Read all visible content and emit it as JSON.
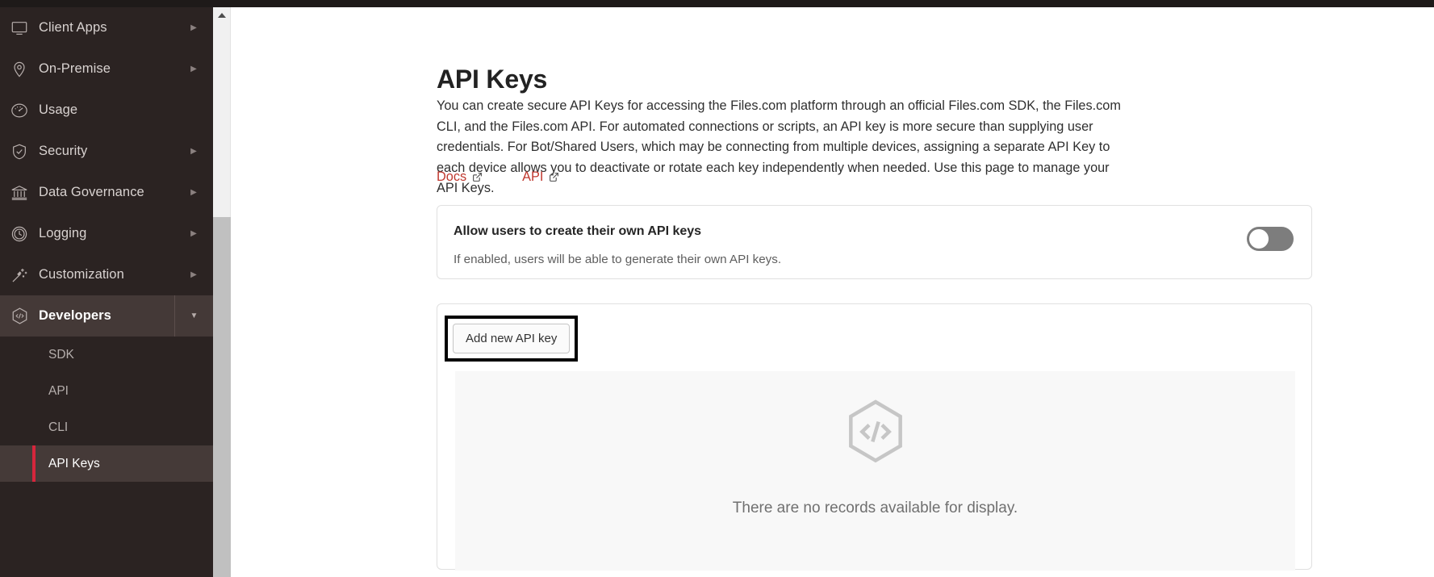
{
  "sidebar": {
    "items": [
      {
        "label": "Client Apps",
        "icon": "monitor-icon",
        "has_arrow": true,
        "arrow": "▶"
      },
      {
        "label": "On-Premise",
        "icon": "map-pin-icon",
        "has_arrow": true,
        "arrow": "▶"
      },
      {
        "label": "Usage",
        "icon": "gauge-icon",
        "has_arrow": false,
        "arrow": ""
      },
      {
        "label": "Security",
        "icon": "shield-check-icon",
        "has_arrow": true,
        "arrow": "▶"
      },
      {
        "label": "Data Governance",
        "icon": "bank-icon",
        "has_arrow": true,
        "arrow": "▶"
      },
      {
        "label": "Logging",
        "icon": "clock-icon",
        "has_arrow": true,
        "arrow": "▶"
      },
      {
        "label": "Customization",
        "icon": "magic-wand-icon",
        "has_arrow": true,
        "arrow": "▶"
      },
      {
        "label": "Developers",
        "icon": "hexagon-code-icon",
        "has_arrow": true,
        "arrow": "▼",
        "expanded": true
      }
    ],
    "developers_subitems": [
      {
        "label": "SDK",
        "active": false
      },
      {
        "label": "API",
        "active": false
      },
      {
        "label": "CLI",
        "active": false
      },
      {
        "label": "API Keys",
        "active": true
      }
    ],
    "active_item": "API Keys",
    "colors": {
      "background": "#2b2322",
      "active_background": "#453a38",
      "active_accent": "#d6263c",
      "label": "#d8d2d0"
    }
  },
  "main": {
    "title": "API Keys",
    "description": "You can create secure API Keys for accessing the Files.com platform through an official Files.com SDK, the Files.com CLI, and the Files.com API. For automated connections or scripts, an API key is more secure than supplying user credentials. For Bot/Shared Users, which may be connecting from multiple devices, assigning a separate API Key to each device allows you to deactivate or rotate each key independently when needed. Use this page to manage your API Keys.",
    "links": [
      {
        "label": "Docs",
        "icon": "external-link-icon"
      },
      {
        "label": "API",
        "icon": "external-link-icon"
      }
    ],
    "link_color": "#c0392f",
    "settings_card": {
      "title": "Allow users to create their own API keys",
      "description": "If enabled, users will be able to generate their own API keys.",
      "toggle_state": "off",
      "toggle_track_color": "#7d7d7d"
    },
    "keys_card": {
      "add_button_label": "Add new API key",
      "add_button_focused": true,
      "empty_state": {
        "icon": "hexagon-code-icon",
        "message": "There are no records available for display."
      }
    }
  },
  "scrollbar": {
    "up_arrow_icon": "triangle-up-icon",
    "thumb_color": "#c0c0c0",
    "track_color": "#f0f0f0"
  }
}
